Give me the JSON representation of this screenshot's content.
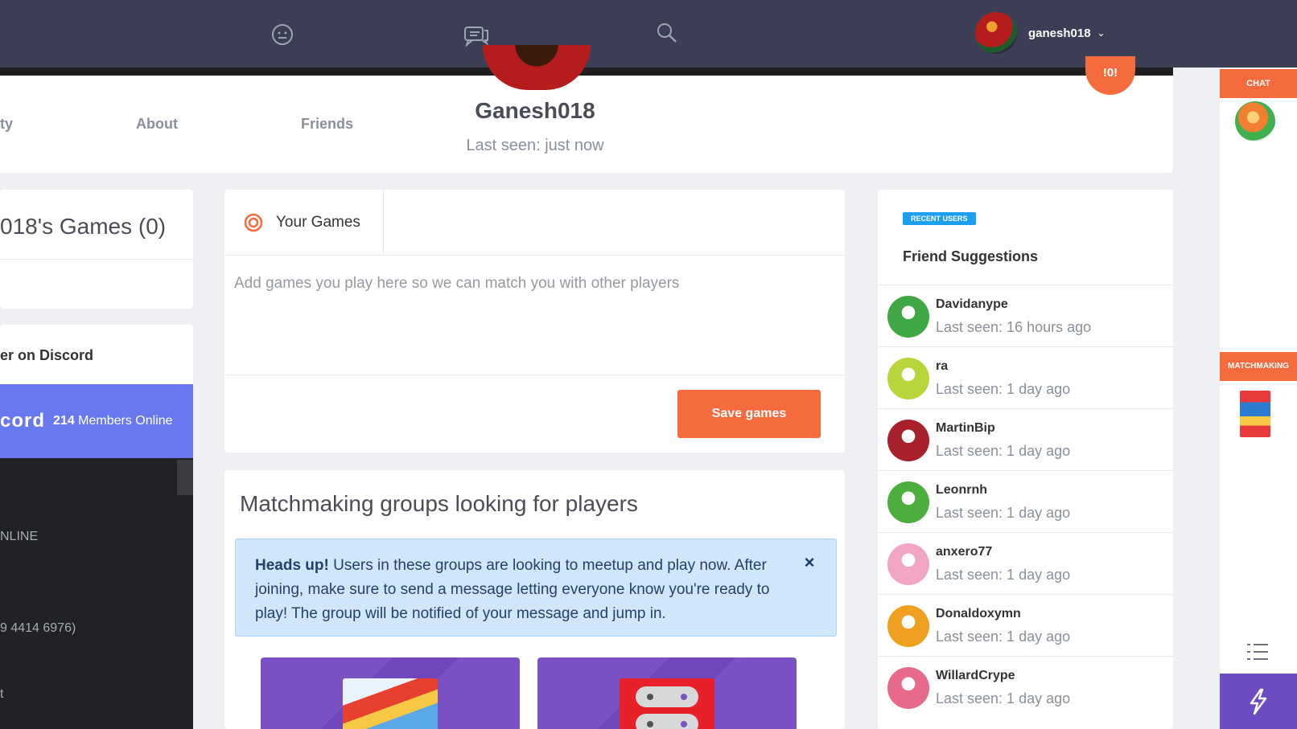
{
  "topnav": {
    "icons": [
      "emoji-icon",
      "chat-bubbles-icon",
      "search-icon"
    ],
    "username": "ganesh018"
  },
  "profile": {
    "tabs": [
      "ty",
      "About",
      "Friends"
    ],
    "name": "Ganesh018",
    "last_seen": "Last seen: just now",
    "fab_label": "!0!"
  },
  "left": {
    "games_title": "018's Games (0)",
    "discord_label": "er on Discord",
    "discord_word": "cord",
    "discord_members_count": "214",
    "discord_members_text": "Members Online",
    "lines": [
      "NLINE",
      "9 4414 6976)",
      "t"
    ]
  },
  "games": {
    "tab_label": "Your Games",
    "placeholder": "Add games you play here so we can match you with other players",
    "save_label": "Save games"
  },
  "matchmaking": {
    "title": "Matchmaking groups looking for players",
    "alert_strong": "Heads up!",
    "alert_text": " Users in these groups are looking to meetup and play now. After joining, make sure to send a message letting everyone know you're ready to play! The group will be notified of your message and jump in.",
    "close_label": "×"
  },
  "friend_suggestions": {
    "badge": "RECENT USERS",
    "title": "Friend Suggestions",
    "users": [
      {
        "name": "Davidanype",
        "seen": "Last seen: 16 hours ago",
        "color": "#3fa844"
      },
      {
        "name": "ra",
        "seen": "Last seen: 1 day ago",
        "color": "#b8d63a"
      },
      {
        "name": "MartinBip",
        "seen": "Last seen: 1 day ago",
        "color": "#a8202a"
      },
      {
        "name": "Leonrnh",
        "seen": "Last seen: 1 day ago",
        "color": "#4cae3c"
      },
      {
        "name": "anxero77",
        "seen": "Last seen: 1 day ago",
        "color": "#f2a4c4"
      },
      {
        "name": "Donaldoxymn",
        "seen": "Last seen: 1 day ago",
        "color": "#f0a020"
      },
      {
        "name": "WillardCrype",
        "seen": "Last seen: 1 day ago",
        "color": "#e86a8a"
      }
    ]
  },
  "sidebar": {
    "chat_label": "CHAT",
    "matchmaking_label": "MATCHMAKING"
  },
  "colors": {
    "nav_bg": "#3c3e55",
    "accent": "#f56b3d",
    "discord": "#6a78f0",
    "badge": "#1ea0f0",
    "purple": "#6c4bc3"
  }
}
